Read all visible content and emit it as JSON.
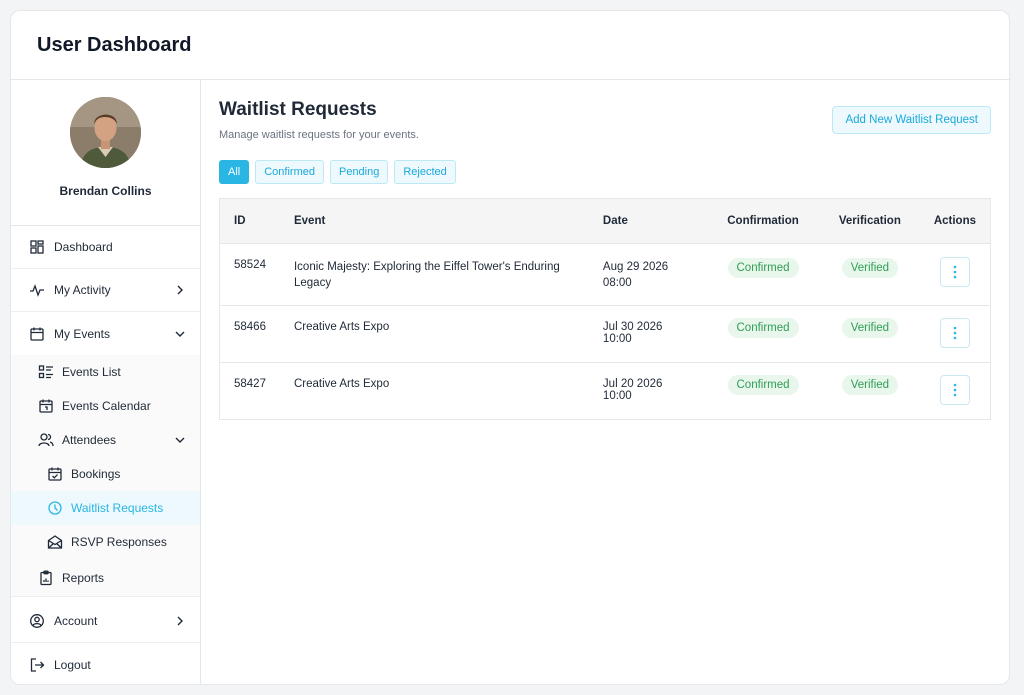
{
  "header": {
    "title": "User Dashboard"
  },
  "profile": {
    "name": "Brendan Collins"
  },
  "sidebar": {
    "items": [
      {
        "label": "Dashboard",
        "icon": "dashboard-grid-icon"
      },
      {
        "label": "My Activity",
        "icon": "activity-pulse-icon"
      },
      {
        "label": "My Events",
        "icon": "calendar-icon"
      },
      {
        "label": "Account",
        "icon": "user-circle-icon"
      },
      {
        "label": "Logout",
        "icon": "logout-icon"
      }
    ],
    "events_sub": [
      {
        "label": "Events List",
        "icon": "list-icon"
      },
      {
        "label": "Events Calendar",
        "icon": "calendar-date-icon"
      },
      {
        "label": "Attendees",
        "icon": "users-icon"
      },
      {
        "label": "Reports",
        "icon": "clipboard-report-icon"
      }
    ],
    "attendees_sub": [
      {
        "label": "Bookings",
        "icon": "calendar-check-icon"
      },
      {
        "label": "Waitlist Requests",
        "icon": "clock-icon",
        "active": true
      },
      {
        "label": "RSVP Responses",
        "icon": "envelope-open-icon"
      }
    ]
  },
  "main": {
    "title": "Waitlist Requests",
    "subtitle": "Manage waitlist requests for your events.",
    "add_button": "Add New Waitlist Request",
    "filters": [
      "All",
      "Confirmed",
      "Pending",
      "Rejected"
    ],
    "active_filter": "All"
  },
  "table": {
    "headers": [
      "ID",
      "Event",
      "Date",
      "Confirmation",
      "Verification",
      "Actions"
    ],
    "rows": [
      {
        "id": "58524",
        "event": "Iconic Majesty: Exploring the Eiffel Tower's Enduring Legacy",
        "date": "Aug 29 2026 08:00",
        "confirmation": "Confirmed",
        "verification": "Verified"
      },
      {
        "id": "58466",
        "event": "Creative Arts Expo",
        "date": "Jul 30 2026 10:00",
        "confirmation": "Confirmed",
        "verification": "Verified"
      },
      {
        "id": "58427",
        "event": "Creative Arts Expo",
        "date": "Jul 20 2026 10:00",
        "confirmation": "Confirmed",
        "verification": "Verified"
      }
    ]
  },
  "colors": {
    "accent": "#29b6e5",
    "accent_soft": "#edf9fd",
    "success_text": "#2f9e55",
    "success_bg": "#e8f6ec"
  }
}
